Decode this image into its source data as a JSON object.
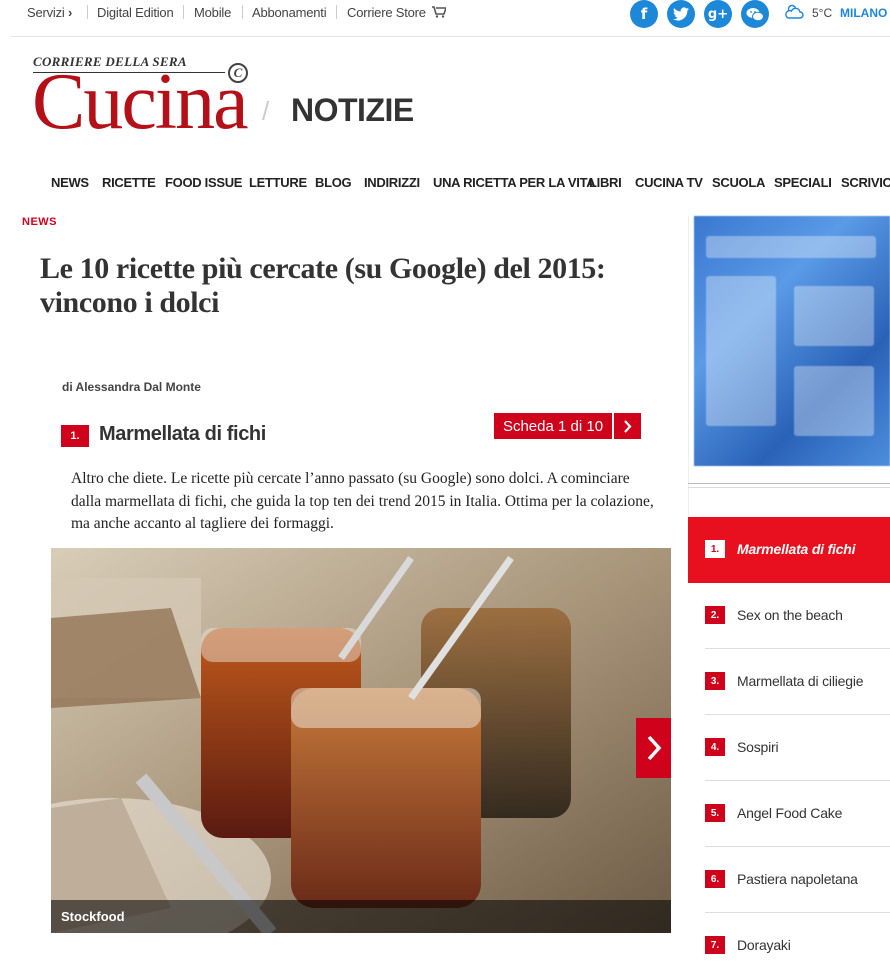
{
  "topbar": {
    "links": [
      "Servizi",
      "Digital Edition",
      "Mobile",
      "Abbonamenti",
      "Corriere Store"
    ],
    "servizi_chevron": "›",
    "social": [
      "f",
      "t",
      "g+",
      "wechat"
    ],
    "weather_temp": "5°C",
    "city": "MILANO"
  },
  "brand": {
    "small": "CORRIERE DELLA SERA",
    "big": "Cucina",
    "c_mark": "C",
    "slash": "/",
    "section": "NOTIZIE"
  },
  "nav": {
    "items": [
      "NEWS",
      "RICETTE",
      "FOOD ISSUE",
      "LETTURE",
      "BLOG",
      "INDIRIZZI",
      "UNA RICETTA PER LA VITA",
      "LIBRI",
      "CUCINA TV",
      "SCUOLA",
      "SPECIALI",
      "SCRIVICI"
    ]
  },
  "article": {
    "kicker": "NEWS",
    "title": "Le 10 ricette più cercate (su Google) del 2015: vincono i dolci",
    "byline": "di Alessandra Dal Monte",
    "item_number": "1.",
    "item_title": "Marmellata di fichi",
    "scheda": "Scheda 1 di 10",
    "body": "Altro che diete. Le ricette più cercate l’anno passato (su Google) sono dolci. A cominciare dalla marmellata di fichi, che guida la top ten dei trend 2015 in Italia. Ottima per la colazione, ma anche accanto al tagliere dei formaggi.",
    "photo_caption": "Stockfood"
  },
  "sidebar": {
    "items": [
      {
        "num": "1.",
        "label": "Marmellata di fichi",
        "active": true
      },
      {
        "num": "2.",
        "label": "Sex on the beach"
      },
      {
        "num": "3.",
        "label": "Marmellata di ciliegie"
      },
      {
        "num": "4.",
        "label": "Sospiri"
      },
      {
        "num": "5.",
        "label": "Angel Food Cake"
      },
      {
        "num": "6.",
        "label": "Pastiera napoletana"
      },
      {
        "num": "7.",
        "label": "Dorayaki"
      }
    ]
  },
  "colors": {
    "accent": "#d0021b",
    "logo": "#b50f18",
    "social": "#1e88d8"
  }
}
